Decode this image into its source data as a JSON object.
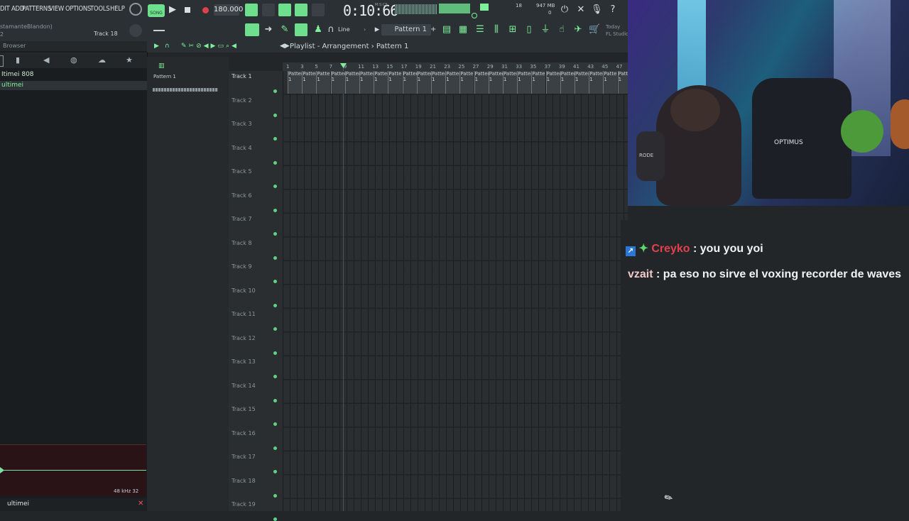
{
  "menu": [
    "DIT",
    "ADD",
    "PATTERNS",
    "VIEW",
    "OPTIONS",
    "TOOLS",
    "HELP"
  ],
  "transport": {
    "tempo": "180.000",
    "time": "0:10:66",
    "time_mode": "M:S:CS",
    "memory": "947 MB",
    "cpu_num": "18",
    "cpu_zero": "0",
    "song_label": "SONG"
  },
  "toolbar": {
    "snap_label": "Line",
    "pattern": "Pattern 1",
    "today_label": "Today",
    "fl_label": "FL Studio",
    "project": "stamanteBlandon)",
    "track_hint": "Track 18",
    "num": "2"
  },
  "browser": {
    "title": "Browser",
    "items": [
      "Itimei 808",
      "ultimei"
    ],
    "sample_rate": "48 kHz 32",
    "file": "ultimei"
  },
  "playlist": {
    "breadcrumb_1": "Playlist - Arrangement",
    "breadcrumb_2": "Pattern 1",
    "picker_item": "Pattern 1",
    "ruler": [
      "1",
      "3",
      "5",
      "7",
      "9",
      "11",
      "13",
      "15",
      "17",
      "19",
      "21",
      "23",
      "25",
      "27",
      "29",
      "31",
      "33",
      "35",
      "37",
      "39",
      "41",
      "43",
      "45",
      "47"
    ],
    "tracks": [
      "Track 1",
      "Track 2",
      "Track 3",
      "Track 4",
      "Track 5",
      "Track 6",
      "Track 7",
      "Track 8",
      "Track 9",
      "Track 10",
      "Track 11",
      "Track 12",
      "Track 13",
      "Track 14",
      "Track 15",
      "Track 16",
      "Track 17",
      "Track 18",
      "Track 19"
    ],
    "clip_label": "Pattern 1"
  },
  "chat": {
    "messages": [
      {
        "user": "Creyko",
        "sep": " : ",
        "text": "you you yoi",
        "color": "#e3404b"
      },
      {
        "user": "vzait",
        "sep": " : ",
        "text": "pa eso no sirve el voxing recorder de waves",
        "color": "#f3c7c9"
      }
    ]
  },
  "webcam": {
    "chair_brand": "OPTIMUS",
    "mic_label": "RODE"
  },
  "colors": {
    "accent": "#6ee08d",
    "bg": "#222629"
  }
}
